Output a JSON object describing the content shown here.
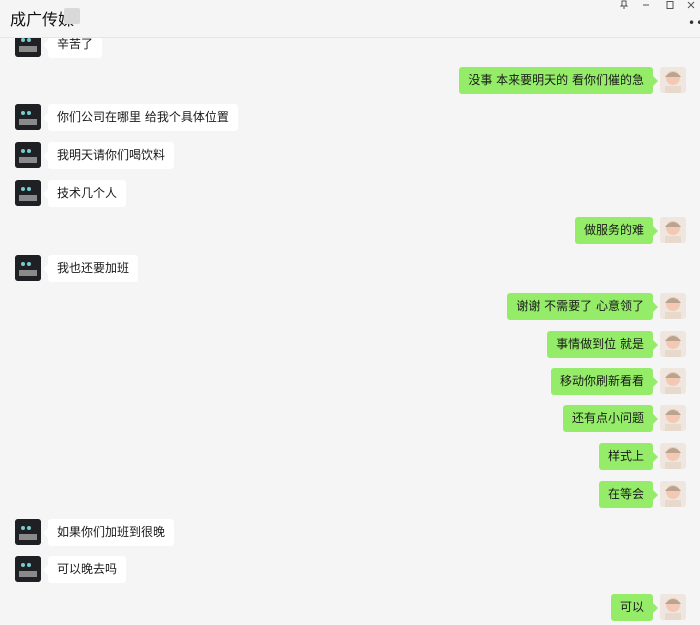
{
  "window": {
    "title": "成广传媒",
    "more_icon": "more-dots-icon",
    "controls": [
      "pin-icon",
      "minimize-icon",
      "maximize-icon",
      "close-icon"
    ]
  },
  "colors": {
    "background": "#f5f5f5",
    "bubble_incoming": "#ffffff",
    "bubble_outgoing": "#95ec69"
  },
  "messages": [
    {
      "side": "left",
      "text": "辛苦了"
    },
    {
      "side": "right",
      "text": "没事 本来要明天的 看你们催的急"
    },
    {
      "side": "left",
      "text": "你们公司在哪里 给我个具体位置"
    },
    {
      "side": "left",
      "text": "我明天请你们喝饮料"
    },
    {
      "side": "left",
      "text": "技术几个人"
    },
    {
      "side": "right",
      "text": "做服务的难"
    },
    {
      "side": "left",
      "text": "我也还要加班"
    },
    {
      "side": "right",
      "text": "谢谢 不需要了 心意领了"
    },
    {
      "side": "right",
      "text": "事情做到位 就是"
    },
    {
      "side": "right",
      "text": "移动你刷新看看"
    },
    {
      "side": "right",
      "text": "还有点小问题"
    },
    {
      "side": "right",
      "text": "样式上"
    },
    {
      "side": "right",
      "text": "在等会"
    },
    {
      "side": "left",
      "text": "如果你们加班到很晚"
    },
    {
      "side": "left",
      "text": "可以晚去吗"
    },
    {
      "side": "right",
      "text": "可以"
    }
  ]
}
